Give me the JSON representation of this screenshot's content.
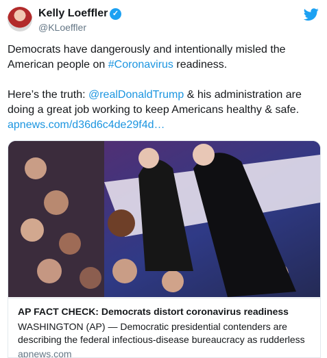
{
  "author": {
    "name": "Kelly Loeffler",
    "handle": "@KLoeffler"
  },
  "tweet": {
    "line1_text": "Democrats have dangerously and intentionally misled the American people on ",
    "hashtag": "#Coronavirus",
    "line1_tail": " readiness.",
    "line2_lead": "Here’s the truth: ",
    "mention": "@realDonaldTrump",
    "line2_text": " & his administration are doing a great job working to keep Americans healthy & safe.",
    "link": "apnews.com/d36d6c4de29f4d…"
  },
  "card": {
    "title": "AP FACT CHECK: Democrats distort coronavirus readiness",
    "description": "WASHINGTON (AP) — Democratic presidential contenders are describing the federal infectious-disease bureaucracy as rudderless",
    "domain": "apnews.com"
  },
  "colors": {
    "link": "#1b95e0",
    "verified": "#1da1f2",
    "secondary_text": "#657786"
  },
  "icons": [
    "verified-badge-icon",
    "twitter-bird-icon"
  ]
}
